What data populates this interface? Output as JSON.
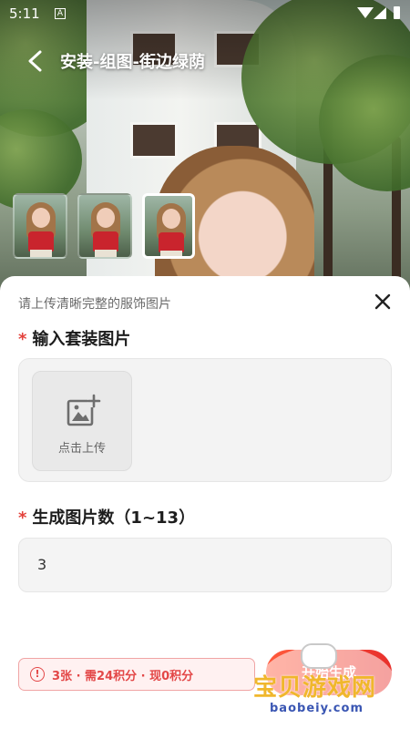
{
  "status_bar": {
    "time": "5:11",
    "notification_glyph": "A"
  },
  "header": {
    "title": "安装-组图-街边绿荫",
    "back_icon": "chevron-left-icon"
  },
  "thumbnails": [
    {
      "id": "thumb-1",
      "selected": false
    },
    {
      "id": "thumb-2",
      "selected": false
    },
    {
      "id": "thumb-3",
      "selected": true
    }
  ],
  "sheet": {
    "hint": "请上传清晰完整的服饰图片",
    "close_icon": "close-icon",
    "required_mark": "*",
    "outfit_section": {
      "label": "输入套装图片",
      "upload_label": "点击上传",
      "upload_icon": "add-image-icon"
    },
    "count_section": {
      "label": "生成图片数（1~13）",
      "value": "3"
    },
    "cost_notice": {
      "icon": "warning-icon",
      "glyph": "!",
      "text": "3张 · 需24积分 · 现0积分"
    },
    "generate_button": {
      "label": "开始生成"
    }
  },
  "watermark": {
    "cn": "宝贝游戏网",
    "en": "baobeiy.com"
  },
  "colors": {
    "accent_red": "#e8302c",
    "required_red": "#e3413b",
    "warning_bg": "#fff1f1"
  }
}
